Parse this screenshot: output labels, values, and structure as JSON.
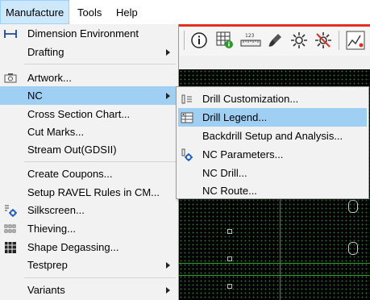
{
  "menubar": {
    "items": [
      {
        "label": "Manufacture",
        "active": true
      },
      {
        "label": "Tools"
      },
      {
        "label": "Help"
      }
    ]
  },
  "toolbar": {
    "icons": [
      "dimension-icon",
      "info-icon",
      "grid-info-icon",
      "measure-ruler-icon",
      "paint-brush-icon",
      "sun-highlight-icon",
      "dehighlight-icon",
      "chart-icon"
    ],
    "ruler_text": "123"
  },
  "manufacture_menu": {
    "items": [
      {
        "label": "Dimension Environment",
        "icon": "dimension-icon"
      },
      {
        "label": "Drafting",
        "submenu": true
      },
      {
        "label": "Artwork...",
        "icon": "camera-icon"
      },
      {
        "label": "NC",
        "submenu": true,
        "active": true
      },
      {
        "label": "Cross Section Chart..."
      },
      {
        "label": "Cut Marks..."
      },
      {
        "label": "Stream Out(GDSII)"
      },
      {
        "label": "Create Coupons..."
      },
      {
        "label": "Setup RAVEL Rules in CM..."
      },
      {
        "label": "Silkscreen...",
        "icon": "silkscreen-gear-icon"
      },
      {
        "label": "Thieving...",
        "icon": "thieving-icon"
      },
      {
        "label": "Shape Degassing...",
        "icon": "degassing-grid-icon"
      },
      {
        "label": "Testprep",
        "submenu": true
      },
      {
        "label": "Variants",
        "submenu": true
      }
    ]
  },
  "nc_submenu": {
    "items": [
      {
        "label": "Drill Customization...",
        "icon": "drill-customization-icon"
      },
      {
        "label": "Drill Legend...",
        "icon": "drill-legend-icon",
        "active": true
      },
      {
        "label": "Backdrill Setup and Analysis..."
      },
      {
        "label": "NC Parameters...",
        "icon": "nc-parameters-icon"
      },
      {
        "label": "NC Drill..."
      },
      {
        "label": "NC Route..."
      }
    ]
  },
  "colors": {
    "menu_highlight": "#9fd0f3",
    "accent_line": "#e03020",
    "pcb_trace": "#2fa02f",
    "canvas_bg": "#000000"
  }
}
